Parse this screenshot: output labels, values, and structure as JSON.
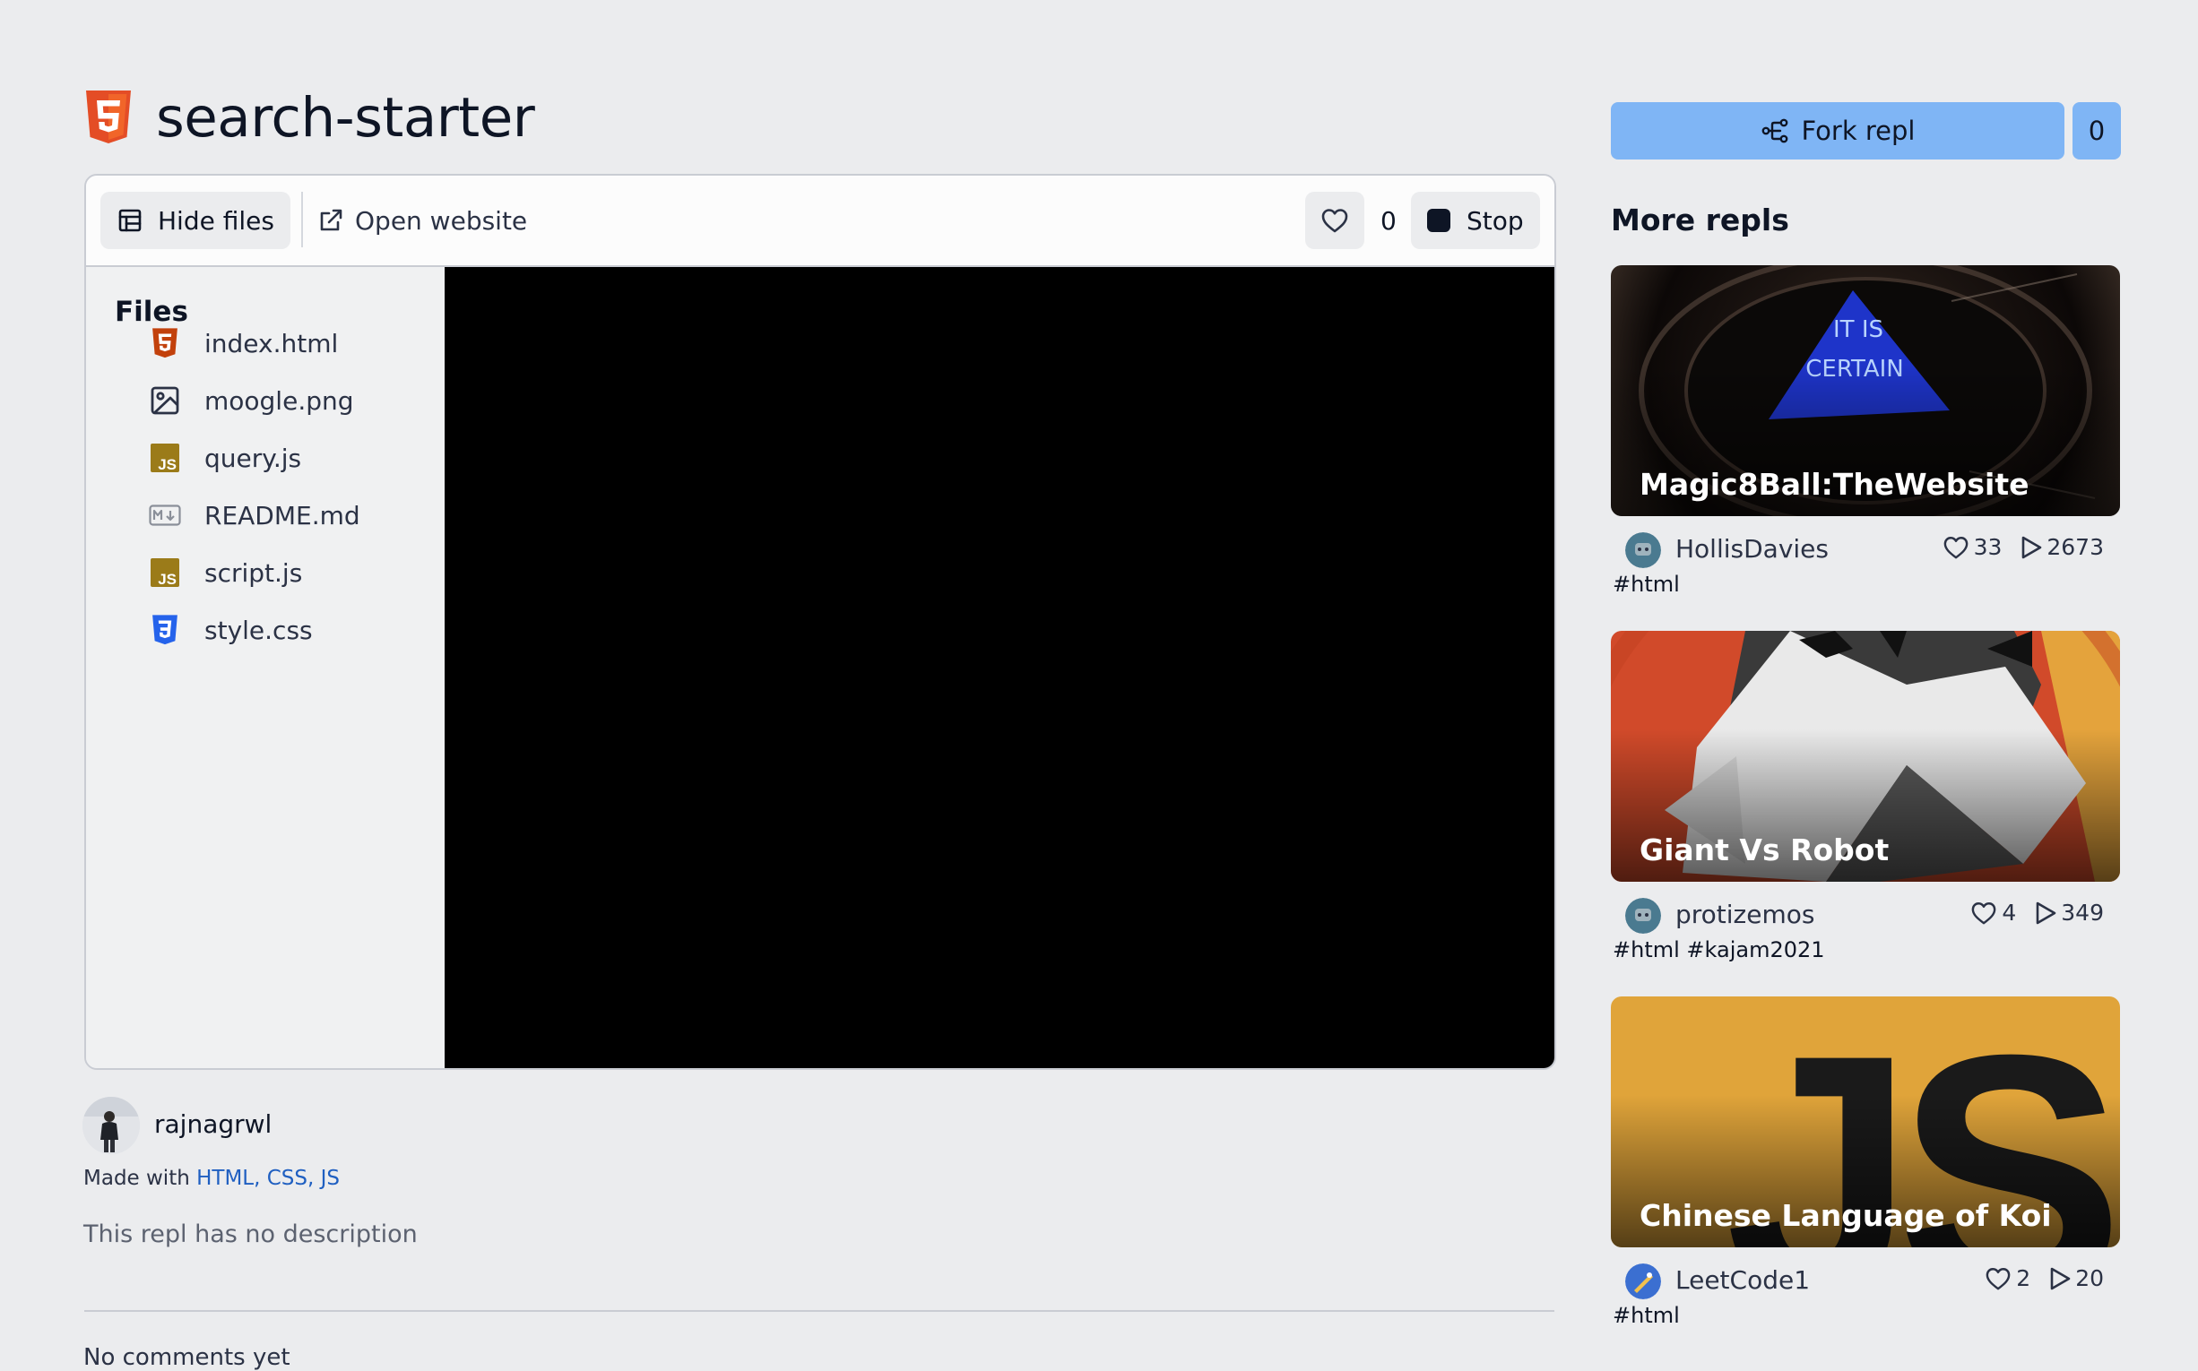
{
  "repl": {
    "title": "search-starter",
    "language_icon": "html5-icon"
  },
  "toolbar": {
    "hide_files_label": "Hide files",
    "open_website_label": "Open website",
    "like_count": "0",
    "stop_label": "Stop"
  },
  "files": {
    "heading": "Files",
    "items": [
      {
        "name": "index.html",
        "icon": "html5-file-icon",
        "color": "#c2410c"
      },
      {
        "name": "moogle.png",
        "icon": "image-file-icon",
        "color": "#2b3245"
      },
      {
        "name": "query.js",
        "icon": "js-file-icon",
        "color": "#9b7b19"
      },
      {
        "name": "README.md",
        "icon": "markdown-file-icon",
        "color": "#8a8f99"
      },
      {
        "name": "script.js",
        "icon": "js-file-icon",
        "color": "#9b7b19"
      },
      {
        "name": "style.css",
        "icon": "css3-file-icon",
        "color": "#2563eb"
      }
    ]
  },
  "author": {
    "name": "rajnagrwl",
    "made_with_prefix": "Made with",
    "languages": "HTML, CSS, JS",
    "description": "This repl has no description"
  },
  "comments": {
    "empty_text": "No comments yet"
  },
  "sidebar": {
    "fork_label": "Fork repl",
    "fork_count": "0",
    "more_heading": "More repls",
    "cards": [
      {
        "title": "Magic8Ball:TheWebsite",
        "owner": "HollisDavies",
        "likes": "33",
        "runs": "2673",
        "tags": "#html",
        "thumb_text": [
          "IT IS",
          "CERTAIN"
        ]
      },
      {
        "title": "Giant Vs Robot",
        "owner": "protizemos",
        "likes": "4",
        "runs": "349",
        "tags": "#html #kajam2021"
      },
      {
        "title": "Chinese Language of Koi",
        "owner": "LeetCode1",
        "likes": "2",
        "runs": "20",
        "tags": "#html",
        "thumb_text": [
          "JS"
        ]
      }
    ]
  },
  "colors": {
    "fork_button": "#7fb5f5",
    "page_background": "#ebecee",
    "html_orange": "#e44d26",
    "link_blue": "#1f5fc1"
  }
}
